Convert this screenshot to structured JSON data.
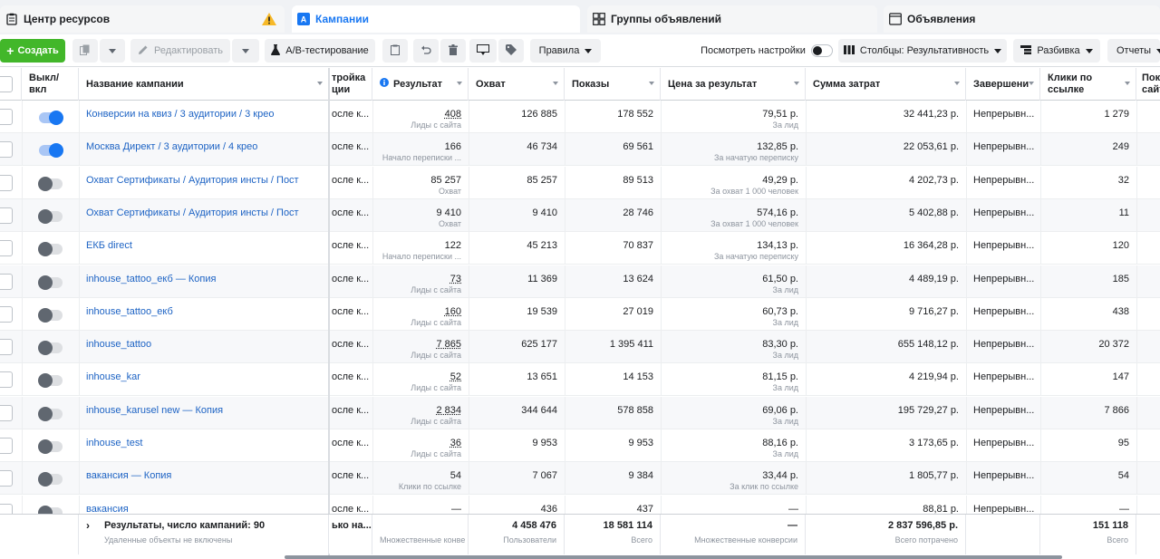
{
  "tabs": {
    "resources": "Центр ресурсов",
    "campaigns": "Кампании",
    "adsets": "Группы объявлений",
    "ads": "Объявления"
  },
  "toolbar": {
    "create": "Создать",
    "edit": "Редактировать",
    "ab_test": "A/B-тестирование",
    "rules": "Правила",
    "view_settings": "Посмотреть настройки",
    "columns": "Столбцы: Результативность",
    "breakdown": "Разбивка",
    "reports": "Отчеты"
  },
  "columns": {
    "onoff": "Выкл/ вкл",
    "name": "Название кампании",
    "setting": "тройка ции",
    "result": "Результат",
    "reach": "Охват",
    "impressions": "Показы",
    "cost_per_result": "Цена за результат",
    "spend": "Сумма затрат",
    "end": "Завершени",
    "link_clicks": "Клики по ссылке",
    "more": "Пок сайт"
  },
  "rows": [
    {
      "on": true,
      "name": "Конверсии на квиз / 3 аудитории / 3 крео",
      "setting": "осле к...",
      "result": "408",
      "result_sub": "Лиды с сайта",
      "result_u": true,
      "reach": "126 885",
      "impressions": "178 552",
      "cpr": "79,51 р.",
      "cpr_sub": "За лид",
      "spend": "32 441,23 р.",
      "end": "Непрерывн...",
      "clicks": "1 279"
    },
    {
      "on": true,
      "name": "Москва Директ / 3 аудитории / 4 крео",
      "setting": "осле к...",
      "result": "166",
      "result_sub": "Начало переписки ...",
      "result_u": false,
      "reach": "46 734",
      "impressions": "69 561",
      "cpr": "132,85 р.",
      "cpr_sub": "За начатую переписку",
      "spend": "22 053,61 р.",
      "end": "Непрерывн...",
      "clicks": "249"
    },
    {
      "on": false,
      "name": "Охват Сертификаты / Аудитория инсты / Пост",
      "setting": "осле к...",
      "result": "85 257",
      "result_sub": "Охват",
      "result_u": false,
      "reach": "85 257",
      "impressions": "89 513",
      "cpr": "49,29 р.",
      "cpr_sub": "За охват 1 000 человек",
      "spend": "4 202,73 р.",
      "end": "Непрерывн...",
      "clicks": "32"
    },
    {
      "on": false,
      "name": "Охват Сертификаты / Аудитория инсты / Пост",
      "setting": "осле к...",
      "result": "9 410",
      "result_sub": "Охват",
      "result_u": false,
      "reach": "9 410",
      "impressions": "28 746",
      "cpr": "574,16 р.",
      "cpr_sub": "За охват 1 000 человек",
      "spend": "5 402,88 р.",
      "end": "Непрерывн...",
      "clicks": "11"
    },
    {
      "on": false,
      "name": "ЕКБ direct",
      "setting": "осле к...",
      "result": "122",
      "result_sub": "Начало переписки ...",
      "result_u": false,
      "reach": "45 213",
      "impressions": "70 837",
      "cpr": "134,13 р.",
      "cpr_sub": "За начатую переписку",
      "spend": "16 364,28 р.",
      "end": "Непрерывн...",
      "clicks": "120"
    },
    {
      "on": false,
      "name": "inhouse_tattoo_екб — Копия",
      "setting": "осле к...",
      "result": "73",
      "result_sub": "Лиды с сайта",
      "result_u": true,
      "reach": "11 369",
      "impressions": "13 624",
      "cpr": "61,50 р.",
      "cpr_sub": "За лид",
      "spend": "4 489,19 р.",
      "end": "Непрерывн...",
      "clicks": "185"
    },
    {
      "on": false,
      "name": "inhouse_tattoo_екб",
      "setting": "осле к...",
      "result": "160",
      "result_sub": "Лиды с сайта",
      "result_u": true,
      "reach": "19 539",
      "impressions": "27 019",
      "cpr": "60,73 р.",
      "cpr_sub": "За лид",
      "spend": "9 716,27 р.",
      "end": "Непрерывн...",
      "clicks": "438"
    },
    {
      "on": false,
      "name": "inhouse_tattoo",
      "setting": "осле к...",
      "result": "7 865",
      "result_sub": "Лиды с сайта",
      "result_u": true,
      "reach": "625 177",
      "impressions": "1 395 411",
      "cpr": "83,30 р.",
      "cpr_sub": "За лид",
      "spend": "655 148,12 р.",
      "end": "Непрерывн...",
      "clicks": "20 372"
    },
    {
      "on": false,
      "name": "inhouse_kar",
      "setting": "осле к...",
      "result": "52",
      "result_sub": "Лиды с сайта",
      "result_u": true,
      "reach": "13 651",
      "impressions": "14 153",
      "cpr": "81,15 р.",
      "cpr_sub": "За лид",
      "spend": "4 219,94 р.",
      "end": "Непрерывн...",
      "clicks": "147"
    },
    {
      "on": false,
      "name": "inhouse_karusel new — Копия",
      "setting": "осле к...",
      "result": "2 834",
      "result_sub": "Лиды с сайта",
      "result_u": true,
      "reach": "344 644",
      "impressions": "578 858",
      "cpr": "69,06 р.",
      "cpr_sub": "За лид",
      "spend": "195 729,27 р.",
      "end": "Непрерывн...",
      "clicks": "7 866"
    },
    {
      "on": false,
      "name": "inhouse_test",
      "setting": "осле к...",
      "result": "36",
      "result_sub": "Лиды с сайта",
      "result_u": true,
      "reach": "9 953",
      "impressions": "9 953",
      "cpr": "88,16 р.",
      "cpr_sub": "За лид",
      "spend": "3 173,65 р.",
      "end": "Непрерывн...",
      "clicks": "95"
    },
    {
      "on": false,
      "name": "вакансия — Копия",
      "setting": "осле к...",
      "result": "54",
      "result_sub": "Клики по ссылке",
      "result_u": false,
      "reach": "7 067",
      "impressions": "9 384",
      "cpr": "33,44 р.",
      "cpr_sub": "За клик по ссылке",
      "spend": "1 805,77 р.",
      "end": "Непрерывн...",
      "clicks": "54"
    },
    {
      "on": false,
      "name": "вакансия",
      "setting": "осле к...",
      "result": "—",
      "result_sub": "",
      "result_u": false,
      "reach": "436",
      "impressions": "437",
      "cpr": "—",
      "cpr_sub": "",
      "spend": "88,81 р.",
      "end": "Непрерывн...",
      "clicks": "—"
    }
  ],
  "footer": {
    "results": "Результаты, число кампаний: 90",
    "results_sub": "Удаленные объекты не включены",
    "setting": "ько на...",
    "result_sub": "Множественные конве",
    "reach": "4 458 476",
    "reach_sub": "Пользователи",
    "impressions": "18 581 114",
    "impressions_sub": "Всего",
    "cpr": "—",
    "cpr_sub": "Множественные конверсии",
    "spend": "2 837 596,85 р.",
    "spend_sub": "Всего потрачено",
    "clicks": "151 118",
    "clicks_sub": "Всего"
  }
}
